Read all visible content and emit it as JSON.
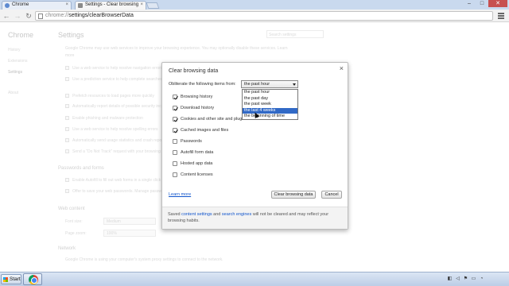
{
  "tabs": [
    {
      "title": "Chrome",
      "favicon_color": "#5d8ad0"
    },
    {
      "title": "Settings - Clear browsing",
      "favicon_color": "#8a8a8a"
    }
  ],
  "omnibox": {
    "scheme": "chrome://",
    "path": "settings/clearBrowserData"
  },
  "window_controls": {
    "minimize": "–",
    "maximize": "□",
    "close": "✕"
  },
  "background_page": {
    "sidebar_title": "Chrome",
    "sidebar_items": [
      "History",
      "Extensions",
      "Settings",
      "About"
    ],
    "title": "Settings",
    "search_placeholder": "Search settings",
    "privacy_intro": "Google Chrome may use web services to improve your browsing experience. You may optionally disable these services. Learn more",
    "privacy_options": [
      "Use a web service to help resolve navigation errors",
      "Use a prediction service to help complete searches",
      "Prefetch resources to load pages more quickly",
      "Automatically report details of possible security incidents",
      "Enable phishing and malware protection",
      "Use a web service to help resolve spelling errors",
      "Automatically send usage statistics and crash reports",
      "Send a \"Do Not Track\" request with your browsing traffic"
    ],
    "passwords_heading": "Passwords and forms",
    "passwords_options": [
      "Enable Autofill to fill out web forms in a single click",
      "Offer to save your web passwords. Manage passwords"
    ],
    "webcontent_heading": "Web content",
    "font_size_label": "Font size:",
    "font_size_value": "Medium",
    "page_zoom_label": "Page zoom:",
    "page_zoom_value": "100%",
    "network_heading": "Network",
    "network_text": "Google Chrome is using your computer's system proxy settings to connect to the network."
  },
  "dialog": {
    "title": "Clear browsing data",
    "close_glyph": "×",
    "obliterate_label": "Obliterate the following items from:",
    "time_range": {
      "selected": "the past hour",
      "options": [
        "the past hour",
        "the past day",
        "the past week",
        "the last 4 weeks",
        "the beginning of time"
      ],
      "highlighted_index": 3
    },
    "options": [
      {
        "label": "Browsing history",
        "checked": true
      },
      {
        "label": "Download history",
        "checked": true
      },
      {
        "label": "Cookies and other site and plug-in data",
        "checked": true
      },
      {
        "label": "Cached images and files",
        "checked": true
      },
      {
        "label": "Passwords",
        "checked": false
      },
      {
        "label": "Autofill form data",
        "checked": false
      },
      {
        "label": "Hosted app data",
        "checked": false
      },
      {
        "label": "Content licenses",
        "checked": false
      }
    ],
    "learn_more": "Learn more",
    "clear_button": "Clear browsing data",
    "cancel_button": "Cancel",
    "footer": {
      "pre": "Saved ",
      "link1": "content settings",
      "mid": " and ",
      "link2": "search engines",
      "post": " will not be cleared and may reflect your browsing habits."
    }
  },
  "taskbar": {
    "start_label": "Start",
    "tray_icons": [
      "network-icon",
      "volume-icon",
      "flag-icon",
      "battery-icon",
      "clock-icon"
    ],
    "tray_glyphs": [
      "◧",
      "◁",
      "⚑",
      "▭",
      "◔"
    ]
  }
}
